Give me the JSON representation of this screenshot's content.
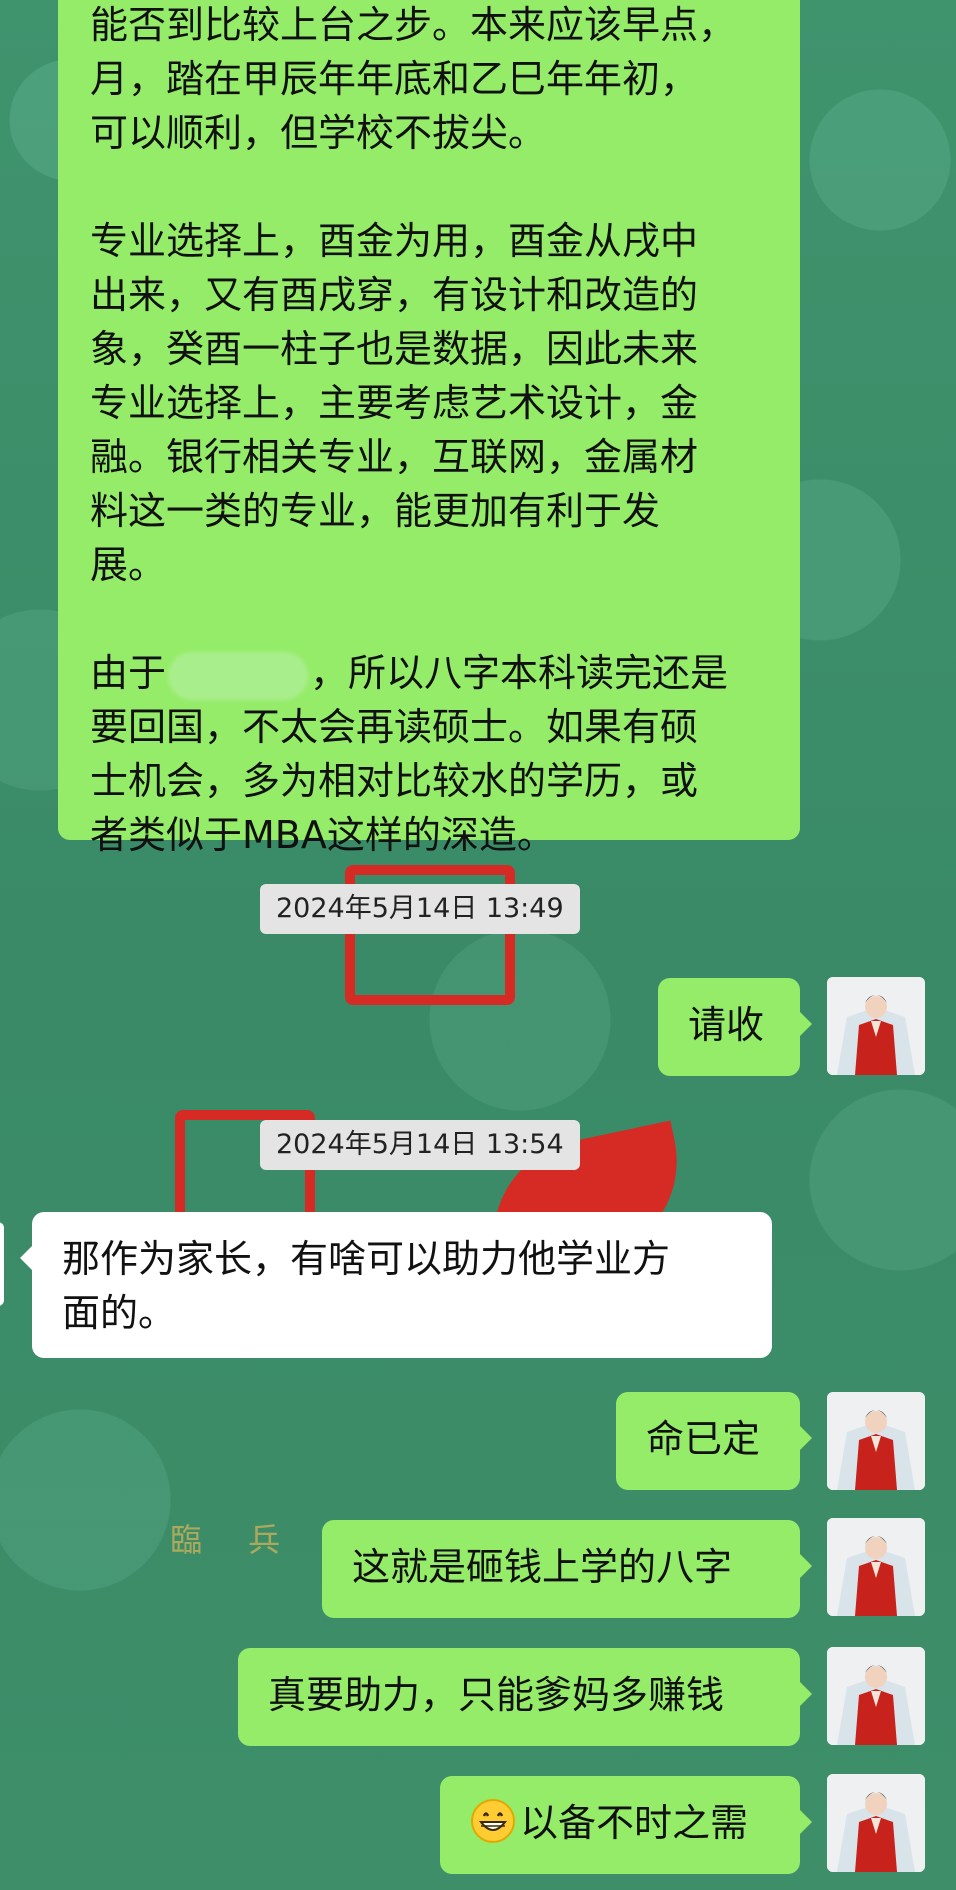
{
  "conversation": {
    "top_message": {
      "paragraphs": [
        "能否到比较上台之步。本来应该早点，\n月，踏在甲辰年年底和乙巳年年初，\n可以顺利，但学校不拔尖。",
        "专业选择上，酉金为用，酉金从戌中\n出来，又有酉戌穿，有设计和改造的\n象，癸酉一柱子也是数据，因此未来\n专业选择上，主要考虑艺术设计，金\n融。银行相关专业，互联网，金属材\n料这一类的专业，能更加有利于发\n展。"
      ],
      "para3_before": "由于",
      "para3_after": "，所以八字本科读完还是\n要回国，不太会再读硕士。如果有硕\n士机会，多为相对比较水的学历，或\n者类似于MBA这样的深造。"
    },
    "timestamp1": "2024年5月14日 13:49",
    "msg_receipt": "请收",
    "timestamp2": "2024年5月14日 13:54",
    "msg_parent": "那作为家长，有啥可以助力他学业方\n面的。",
    "msg_fate": "命已定",
    "msg_money_bazi": "这就是砸钱上学的八字",
    "msg_earn": "真要助力，只能爹妈多赚钱",
    "msg_reserve": "以备不时之需",
    "background_text": "臨 兵 鬪"
  },
  "colors": {
    "outgoing_bubble": "#95ec69",
    "incoming_bubble": "#ffffff",
    "background": "#3f8f6a",
    "timestamp_bg": "#e4e4e4"
  },
  "icons": {
    "avatar": "avatar-woman-red-hanfu",
    "emoji": "grinning-face-emoji"
  }
}
